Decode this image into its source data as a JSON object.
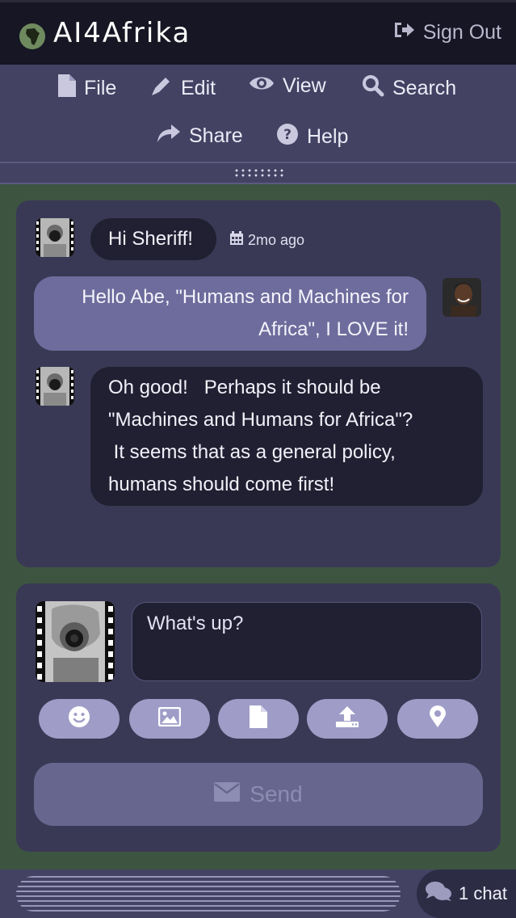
{
  "app": {
    "title": "AI4Afrika",
    "sign_out_label": "Sign Out"
  },
  "icons": {
    "globe": "globe-africa-icon",
    "sign_out": "sign-out-icon",
    "file": "file-icon",
    "edit": "pencil-icon",
    "view": "eye-icon",
    "search": "search-icon",
    "share": "share-icon",
    "help": "question-circle-icon",
    "calendar": "calendar-icon",
    "emoji": "smile-icon",
    "image": "image-icon",
    "document": "file-icon",
    "upload": "upload-icon",
    "location": "map-marker-icon",
    "send": "envelope-icon",
    "chats": "comments-icon"
  },
  "menu": {
    "items": [
      {
        "label": "File"
      },
      {
        "label": "Edit"
      },
      {
        "label": "View"
      },
      {
        "label": "Search"
      },
      {
        "label": "Share"
      },
      {
        "label": "Help"
      }
    ]
  },
  "messages": [
    {
      "text": "Hi Sheriff!",
      "timestamp": "2mo ago"
    },
    {
      "line1": "Hello Abe, \"Humans and Machines for",
      "line2": "Africa\", I LOVE it!"
    },
    {
      "line1": "Oh good!   Perhaps it should be",
      "line2": "\"Machines and Humans for Africa\"?",
      "line3": " It seems that as a general policy,",
      "line4": "humans should come first!"
    }
  ],
  "compose": {
    "placeholder": "What's up?",
    "send_label": "Send"
  },
  "footer": {
    "chat_count_label": "1 chat"
  },
  "colors": {
    "background": "#3d5540",
    "topbar": "#161624",
    "menubar": "#434263",
    "panel": "#3a3955",
    "bubble_dark": "#212032",
    "bubble_light": "#6e6c9c",
    "tool_button": "#9f9dc7",
    "send_button": "#67668f"
  }
}
